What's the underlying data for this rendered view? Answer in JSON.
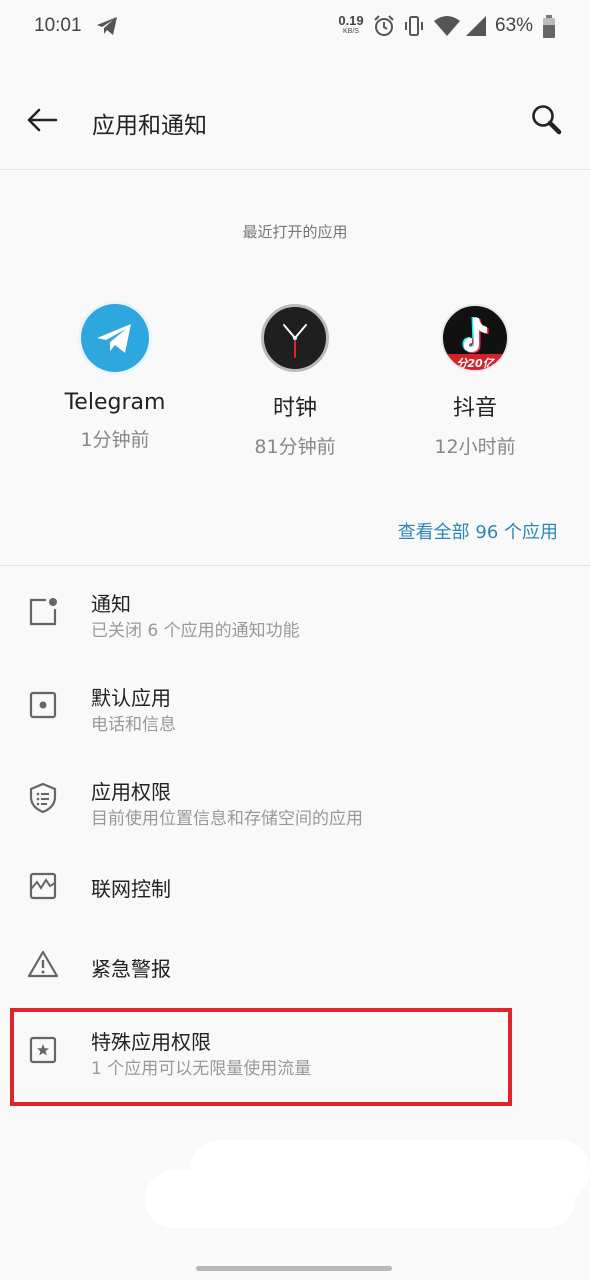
{
  "status_bar": {
    "time": "10:01",
    "net_speed_value": "0.19",
    "net_speed_unit": "KB/S",
    "battery_percent": "63%",
    "icons": [
      "telegram-icon",
      "alarm-icon",
      "vibrate-icon",
      "wifi-icon",
      "signal-icon",
      "battery-icon"
    ]
  },
  "app_bar": {
    "title": "应用和通知",
    "back_icon": "arrow-back-icon",
    "search_icon": "search-icon"
  },
  "recent": {
    "header": "最近打开的应用",
    "apps": [
      {
        "name": "Telegram",
        "time": "1分钟前",
        "icon": "telegram-app-icon"
      },
      {
        "name": "时钟",
        "time": "81分钟前",
        "icon": "clock-app-icon"
      },
      {
        "name": "抖音",
        "time": "12小时前",
        "icon": "douyin-app-icon",
        "badge": "分20亿"
      }
    ],
    "see_all": "查看全部 96 个应用"
  },
  "menu": [
    {
      "title": "通知",
      "subtitle": "已关闭 6 个应用的通知功能",
      "icon": "notification-icon"
    },
    {
      "title": "默认应用",
      "subtitle": "电话和信息",
      "icon": "default-apps-icon"
    },
    {
      "title": "应用权限",
      "subtitle": "目前使用位置信息和存储空间的应用",
      "icon": "permissions-shield-icon"
    },
    {
      "title": "联网控制",
      "subtitle": "",
      "icon": "network-control-icon"
    },
    {
      "title": "紧急警报",
      "subtitle": "",
      "icon": "warning-icon"
    },
    {
      "title": "特殊应用权限",
      "subtitle": "1 个应用可以无限量使用流量",
      "icon": "special-access-icon"
    }
  ],
  "colors": {
    "background": "#f9f9f9",
    "accent_link": "#2e86b7",
    "highlight_border": "#e0242b",
    "telegram_blue": "#2ea6de"
  }
}
